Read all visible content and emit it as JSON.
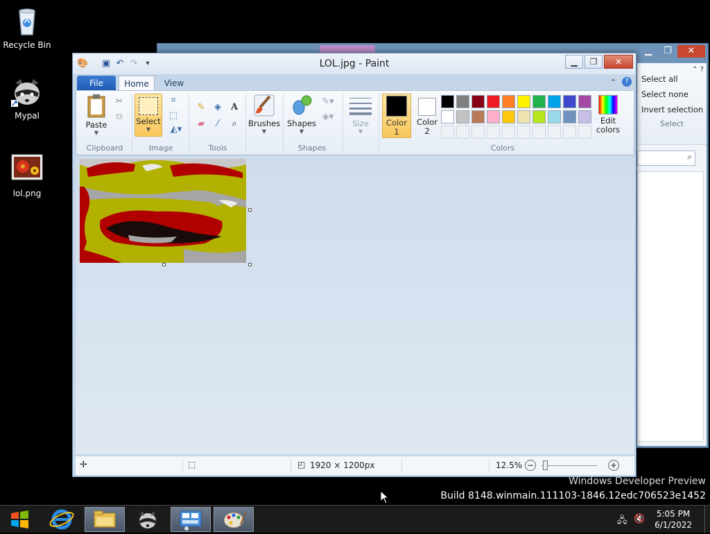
{
  "desktop": {
    "icons": [
      {
        "label": "Recycle Bin"
      },
      {
        "label": "Mypal"
      },
      {
        "label": "lol.png"
      }
    ]
  },
  "background_window": {
    "ribbon_items": [
      "Select all",
      "Select none",
      "Invert selection"
    ],
    "group_label": "Select"
  },
  "paint": {
    "title": "LOL.jpg - Paint",
    "tabs": {
      "file": "File",
      "home": "Home",
      "view": "View"
    },
    "clipboard": {
      "paste": "Paste",
      "group": "Clipboard"
    },
    "image": {
      "select": "Select",
      "group": "Image"
    },
    "tools": {
      "group": "Tools"
    },
    "brushes": {
      "label": "Brushes"
    },
    "shapes": {
      "label": "Shapes",
      "group": "Shapes"
    },
    "size": {
      "label": "Size"
    },
    "colors": {
      "color1": "Color",
      "color1_num": "1",
      "color2": "Color",
      "color2_num": "2",
      "edit": "Edit",
      "edit2": "colors",
      "group": "Colors",
      "color1_value": "#000000",
      "color2_value": "#ffffff",
      "palette_row1": [
        "#000000",
        "#7f7f7f",
        "#880015",
        "#ed1c24",
        "#ff7f27",
        "#fff200",
        "#22b14c",
        "#00a2e8",
        "#3f48cc",
        "#a349a4"
      ],
      "palette_row2": [
        "#ffffff",
        "#c3c3c3",
        "#b97a57",
        "#ffaec9",
        "#ffc90e",
        "#efe4b0",
        "#b5e61d",
        "#99d9ea",
        "#7092be",
        "#c8bfe7"
      ]
    },
    "status": {
      "dimensions": "1920 × 1200px",
      "zoom": "12.5%"
    }
  },
  "watermark": {
    "line1": "Windows Developer Preview",
    "line2": "Build 8148.winmain.111103-1846.12edc706523e1452"
  },
  "taskbar": {
    "time": "5:05 PM",
    "date": "6/1/2022"
  }
}
